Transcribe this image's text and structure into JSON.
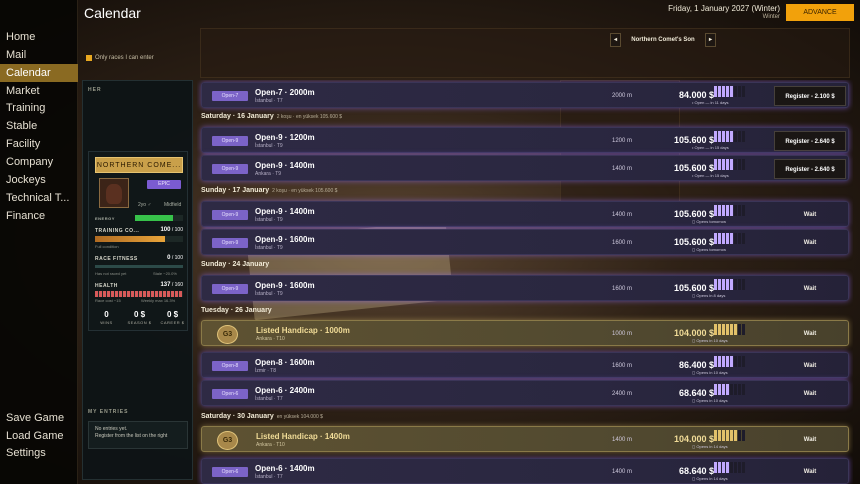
{
  "nav": {
    "items": [
      "Home",
      "Mail",
      "Calendar",
      "Market",
      "Training",
      "Stable",
      "Facility",
      "Company",
      "Jockeys",
      "Technical T...",
      "Finance"
    ],
    "active": "Calendar",
    "bottom": [
      "Save Game",
      "Load Game",
      "Settings"
    ]
  },
  "header": {
    "title": "Calendar",
    "date": "Friday, 1 January 2027 (Winter)",
    "season": "Winter",
    "advance_label": "ADVANCE"
  },
  "filter": {
    "label": "Only races I can enter"
  },
  "horse_nav": {
    "name": "Northern Comet's Son",
    "prev": "◂",
    "next": "▸"
  },
  "left_panel": {
    "header": "HER",
    "horse_card": {
      "name": "NORTHERN COME...",
      "rarity": "EPIC",
      "age": "2yo ♂",
      "style": "Midfield",
      "energy_label": "ENERGY",
      "energy_pct": 0.8,
      "training_label": "TRAINING CO...",
      "training_value": "100",
      "training_max": "/ 100",
      "training_note": "Full condition",
      "training_pct": 0.8,
      "fitness_label": "RACE FITNESS",
      "fitness_value": "0",
      "fitness_max": "/ 100",
      "fitness_note_left": "Has not raced yet",
      "fitness_note_right": "Stale −20.0%",
      "health_label": "HEALTH",
      "health_value": "137",
      "health_max": "/ 160",
      "health_note_left": "Race cost −15",
      "health_note_right": "Weekly max 16.3%",
      "health_pct": 0.85,
      "wins": "0",
      "wins_label": "WINS",
      "season_money": "0 $",
      "season_label": "SEASON $",
      "career_money": "0 $",
      "career_label": "CAREER $"
    },
    "my_entries_header": "MY ENTRIES",
    "my_entries_line1": "No entries yet.",
    "my_entries_line2": "Register from the list on the right"
  },
  "days": [
    {
      "label": "Saturday · 16 January",
      "note": "2 koşu · en yüksek 105.600 $"
    },
    {
      "label": "Sunday · 17 January",
      "note": "2 koşu · en yüksek 105.600 $"
    },
    {
      "label": "Sunday · 24 January",
      "note": ""
    },
    {
      "label": "Tuesday · 26 January",
      "note": ""
    },
    {
      "label": "Saturday · 30 January",
      "note": "en yüksek 104.000 $"
    }
  ],
  "races": [
    {
      "grade": "Open-7",
      "name": "Open-7 · 2000m",
      "track": "İstanbul · T7",
      "dist": "2000 m",
      "prize": "84.000 $",
      "bars": 5,
      "status": "• Open — in 11 days",
      "action": "Register - 2.100 $",
      "kind": "register"
    },
    {
      "grade": "Open-9",
      "name": "Open-9 · 1200m",
      "track": "İstanbul · T9",
      "dist": "1200 m",
      "prize": "105.600 $",
      "bars": 5,
      "status": "• Open — in 15 days",
      "action": "Register - 2.640 $",
      "kind": "register"
    },
    {
      "grade": "Open-9",
      "name": "Open-9 · 1400m",
      "track": "Ankara · T9",
      "dist": "1400 m",
      "prize": "105.600 $",
      "bars": 5,
      "status": "• Open — in 15 days",
      "action": "Register - 2.640 $",
      "kind": "register"
    },
    {
      "grade": "Open-9",
      "name": "Open-9 · 1400m",
      "track": "İstanbul · T9",
      "dist": "1400 m",
      "prize": "105.600 $",
      "bars": 5,
      "status": "◻ Opens tomorrow",
      "action": "Wait",
      "kind": "wait"
    },
    {
      "grade": "Open-9",
      "name": "Open-9 · 1600m",
      "track": "İstanbul · T9",
      "dist": "1600 m",
      "prize": "105.600 $",
      "bars": 5,
      "status": "◻ Opens tomorrow",
      "action": "Wait",
      "kind": "wait"
    },
    {
      "grade": "Open-9",
      "name": "Open-9 · 1600m",
      "track": "İstanbul · T9",
      "dist": "1600 m",
      "prize": "105.600 $",
      "bars": 5,
      "status": "◻ Opens in 8 days",
      "action": "Wait",
      "kind": "wait"
    },
    {
      "grade": "G3",
      "name": "Listed Handicap · 1000m",
      "track": "Ankara · T10",
      "dist": "1000 m",
      "prize": "104.000 $",
      "bars": 6,
      "status": "◻ Opens in 10 days",
      "action": "Wait",
      "kind": "wait",
      "gold": true
    },
    {
      "grade": "Open-8",
      "name": "Open-8 · 1600m",
      "track": "İzmir · T8",
      "dist": "1600 m",
      "prize": "86.400 $",
      "bars": 5,
      "status": "◻ Opens in 10 days",
      "action": "Wait",
      "kind": "wait"
    },
    {
      "grade": "Open-6",
      "name": "Open-6 · 2400m",
      "track": "İstanbul · T7",
      "dist": "2400 m",
      "prize": "68.640 $",
      "bars": 4,
      "status": "◻ Opens in 10 days",
      "action": "Wait",
      "kind": "wait"
    },
    {
      "grade": "G3",
      "name": "Listed Handicap · 1400m",
      "track": "Ankara · T10",
      "dist": "1400 m",
      "prize": "104.000 $",
      "bars": 6,
      "status": "◻ Opens in 14 days",
      "action": "Wait",
      "kind": "wait",
      "gold": true
    },
    {
      "grade": "Open-6",
      "name": "Open-6 · 1400m",
      "track": "İstanbul · T7",
      "dist": "1400 m",
      "prize": "68.640 $",
      "bars": 4,
      "status": "◻ Opens in 14 days",
      "action": "Wait",
      "kind": "wait"
    }
  ]
}
